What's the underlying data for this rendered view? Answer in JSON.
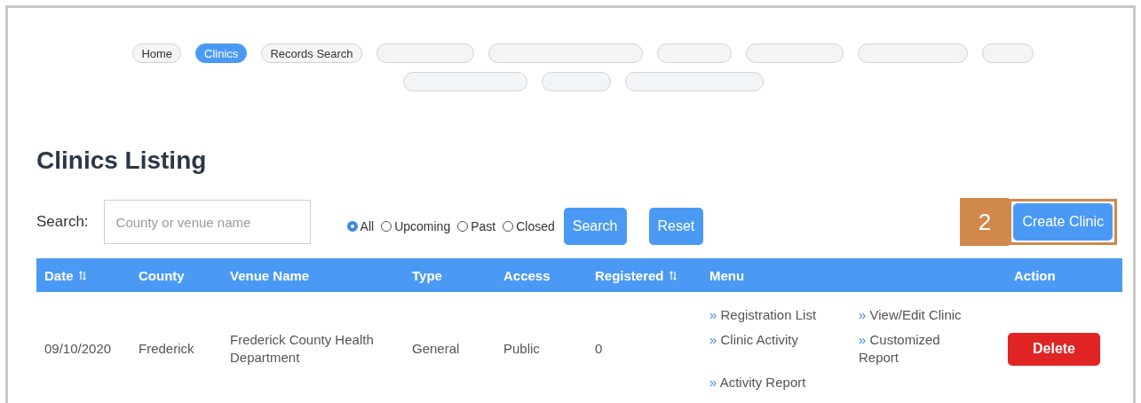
{
  "nav": [
    {
      "kind": "link",
      "label": "Home",
      "selected": false
    },
    {
      "kind": "link",
      "label": "Clinics",
      "selected": true
    },
    {
      "kind": "link",
      "label": "Records Search",
      "selected": false
    },
    {
      "kind": "redacted"
    },
    {
      "kind": "redacted"
    },
    {
      "kind": "redacted"
    },
    {
      "kind": "redacted"
    },
    {
      "kind": "redacted"
    },
    {
      "kind": "redacted"
    },
    {
      "kind": "redacted"
    },
    {
      "kind": "redacted"
    },
    {
      "kind": "redacted"
    }
  ],
  "heading": "Clinics Listing",
  "search": {
    "label": "Search:",
    "placeholder": "County or venue name",
    "filters": [
      {
        "label": "All",
        "selected": true
      },
      {
        "label": "Upcoming",
        "selected": false
      },
      {
        "label": "Past",
        "selected": false
      },
      {
        "label": "Closed",
        "selected": false
      }
    ],
    "buttons": [
      "Search",
      "Reset"
    ]
  },
  "create": {
    "callout": "2",
    "label": "Create Clinic"
  },
  "table": {
    "columns": [
      {
        "label": "Date",
        "sortable": true
      },
      {
        "label": "County",
        "sortable": false
      },
      {
        "label": "Venue Name",
        "sortable": false
      },
      {
        "label": "Type",
        "sortable": false
      },
      {
        "label": "Access",
        "sortable": false
      },
      {
        "label": "Registered",
        "sortable": true
      },
      {
        "label": "Menu",
        "sortable": false
      },
      {
        "label": "Action",
        "sortable": false
      }
    ],
    "rows": [
      {
        "cells": [
          "09/10/2020",
          "Frederick",
          "Frederick County Health Department",
          "General",
          "Public",
          "0"
        ],
        "menu_links": [
          {
            "marker": "»",
            "label": "Registration List"
          },
          {
            "marker": "»",
            "label": "View/Edit Clinic"
          },
          {
            "marker": "»",
            "label": "Clinic Activity"
          },
          {
            "marker": "»",
            "label": "Customized Report"
          },
          {
            "marker": "»",
            "label": "Activity Report"
          }
        ],
        "action": "Delete"
      }
    ]
  }
}
